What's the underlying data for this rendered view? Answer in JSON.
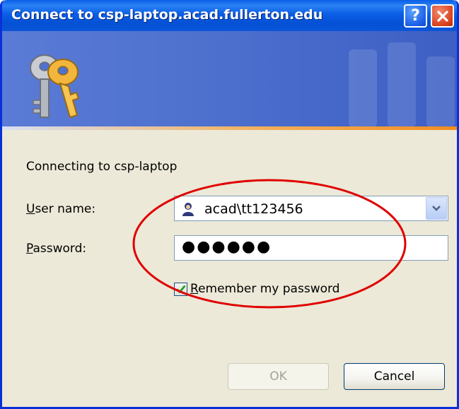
{
  "window": {
    "title": "Connect to csp-laptop.acad.fullerton.edu",
    "help_glyph": "?",
    "close_glyph": "X"
  },
  "banner": {
    "icon": "keys-icon"
  },
  "dialog": {
    "connecting_text": "Connecting to csp-laptop",
    "user_label_first": "U",
    "user_label_rest": "ser name:",
    "password_label_first": "P",
    "password_label_rest": "assword:",
    "username_value": "acad\\tt123456",
    "password_value": "●●●●●●",
    "remember_first": "R",
    "remember_rest": "emember my password",
    "remember_checked": true,
    "ok_label": "OK",
    "cancel_label": "Cancel"
  },
  "colors": {
    "titlebar": "#0a5fe6",
    "banner": "#4f72cf",
    "accent_stripe": "#f28d1f",
    "annotation": "#e00000"
  }
}
